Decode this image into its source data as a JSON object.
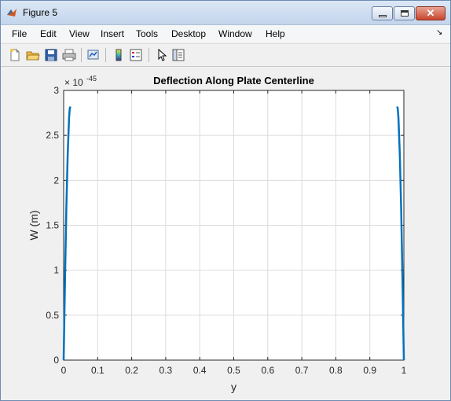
{
  "window": {
    "title": "Figure 5"
  },
  "menu": [
    "File",
    "Edit",
    "View",
    "Insert",
    "Tools",
    "Desktop",
    "Window",
    "Help"
  ],
  "toolbar": [
    "new-figure-icon",
    "open-file-icon",
    "save-icon",
    "print-icon",
    "link-plot-icon",
    "insert-colorbar-icon",
    "insert-legend-icon",
    "edit-plot-arrow-icon",
    "property-inspector-icon"
  ],
  "chart_data": {
    "type": "line",
    "title": "Deflection Along Plate Centerline",
    "xlabel": "y",
    "ylabel": "W (m)",
    "exponent_base": "× 10",
    "exponent_power": "-45",
    "xlim": [
      0,
      1
    ],
    "ylim": [
      0,
      3
    ],
    "xticks": [
      "0",
      "0.1",
      "0.2",
      "0.3",
      "0.4",
      "0.5",
      "0.6",
      "0.7",
      "0.8",
      "0.9",
      "1"
    ],
    "yticks": [
      "0",
      "0.5",
      "1",
      "1.5",
      "2",
      "2.5",
      "3"
    ],
    "grid": true,
    "color": "#0072bd",
    "series": [
      {
        "segments": [
          {
            "x": [
              0.0,
              0.004,
              0.008,
              0.012,
              0.016,
              0.018,
              0.02
            ],
            "y": [
              0.0,
              0.9,
              1.7,
              2.3,
              2.7,
              2.8,
              2.82
            ]
          },
          {
            "x": [
              0.98,
              0.982,
              0.984,
              0.988,
              0.992,
              0.996,
              1.0
            ],
            "y": [
              2.82,
              2.8,
              2.7,
              2.3,
              1.7,
              0.9,
              0.0
            ]
          }
        ]
      }
    ]
  }
}
